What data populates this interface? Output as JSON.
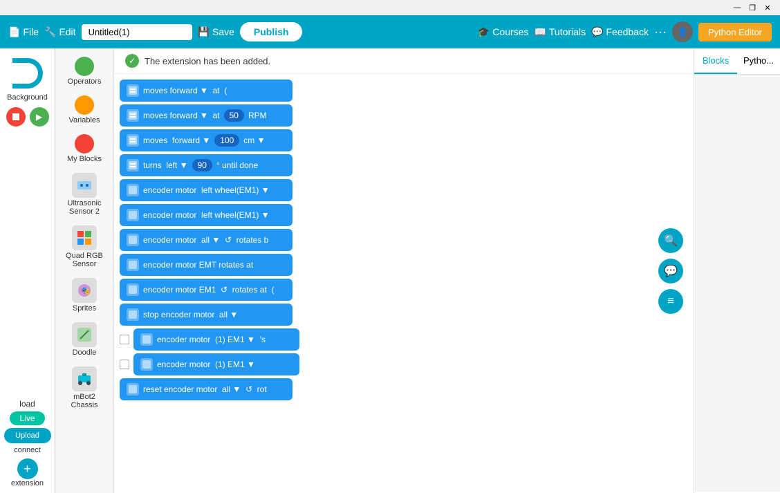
{
  "titlebar": {
    "minimize_label": "—",
    "restore_label": "❐",
    "close_label": "✕"
  },
  "navbar": {
    "file_label": "File",
    "edit_label": "Edit",
    "title_value": "Untitled(1)",
    "save_label": "Save",
    "publish_label": "Publish",
    "courses_label": "Courses",
    "tutorials_label": "Tutorials",
    "feedback_label": "Feedback",
    "more_label": "···",
    "python_editor_label": "Python Editor"
  },
  "notification": {
    "message": "The extension has been added.",
    "check_icon": "✓"
  },
  "tabs": {
    "blocks_label": "Blocks",
    "python_label": "Pytho..."
  },
  "left_section": {
    "background_label": "Background",
    "load_label": "load",
    "connect_label": "connect"
  },
  "sidebar": {
    "items": [
      {
        "label": "Operators",
        "color": "#4caf50",
        "type": "circle"
      },
      {
        "label": "Variables",
        "color": "#ff9800",
        "type": "circle"
      },
      {
        "label": "My Blocks",
        "color": "#f44336",
        "type": "circle"
      },
      {
        "label": "Ultrasonic Sensor 2",
        "icon": "📦",
        "type": "img"
      },
      {
        "label": "Quad RGB Sensor",
        "icon": "📦",
        "type": "img"
      },
      {
        "label": "Sprites",
        "icon": "🎭",
        "type": "img"
      },
      {
        "label": "Doodle",
        "icon": "✏️",
        "type": "img"
      },
      {
        "label": "mBot2 Chassis",
        "icon": "🤖",
        "type": "img"
      }
    ]
  },
  "blocks": [
    {
      "text": "moves forward ▼  at  (",
      "type": "motion",
      "partial": true
    },
    {
      "text": "moves forward ▼  at  50  RPM",
      "type": "motion",
      "has_value": true,
      "value": "50",
      "unit": "RPM"
    },
    {
      "text": "moves   forward ▼   100   cm ▼",
      "type": "motion",
      "has_value": true,
      "value": "100",
      "unit": "cm"
    },
    {
      "text": "turns   left ▼   90   ° until done",
      "type": "motion",
      "has_value": true,
      "value": "90"
    },
    {
      "text": "encoder motor   left wheel(EM1) ▼",
      "type": "motion"
    },
    {
      "text": "encoder motor   left wheel(EM1) ▼",
      "type": "motion"
    },
    {
      "text": "encoder motor   all ▼   ↺  rotates b",
      "type": "motion"
    },
    {
      "text": "encoder motor EMT rotates at",
      "type": "motion"
    },
    {
      "text": "encoder motor EM1  ↺  rotates at  (",
      "type": "motion"
    },
    {
      "text": "stop encoder motor   all ▼",
      "type": "motion"
    },
    {
      "text": "encoder motor   (1) EM1 ▼  's",
      "type": "motion",
      "has_checkbox": true
    },
    {
      "text": "encoder motor   (1) EM1 ▼",
      "type": "motion",
      "has_checkbox": true
    },
    {
      "text": "reset encoder motor   all ▼  ↺  rot",
      "type": "motion"
    }
  ],
  "right_floating": [
    {
      "icon": "🔍",
      "label": "search"
    },
    {
      "icon": "💬",
      "label": "comment"
    },
    {
      "icon": "≡",
      "label": "menu"
    }
  ]
}
